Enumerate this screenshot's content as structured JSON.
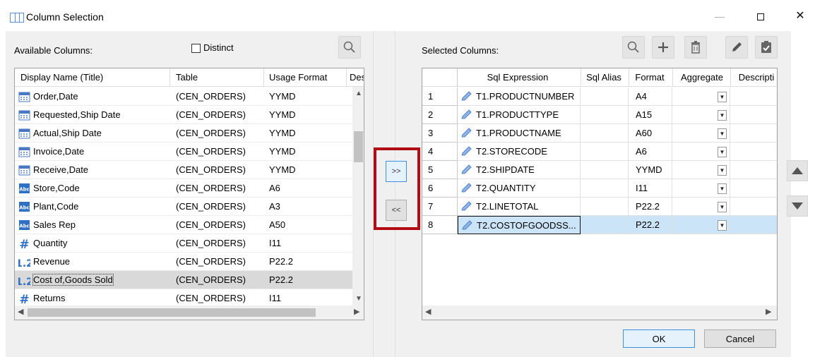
{
  "window": {
    "title": "Column Selection",
    "controls": {
      "minimize": "—",
      "close": "✕"
    }
  },
  "left": {
    "label": "Available Columns:",
    "distinct_label": "Distinct",
    "distinct_checked": false,
    "columns": [
      "Display Name (Title)",
      "Table",
      "Usage Format",
      "Desc"
    ],
    "rows": [
      {
        "icon": "calendar-icon",
        "name": "Order,Date",
        "table": "(CEN_ORDERS)",
        "format": "YYMD"
      },
      {
        "icon": "calendar-icon",
        "name": "Requested,Ship Date",
        "table": "(CEN_ORDERS)",
        "format": "YYMD"
      },
      {
        "icon": "calendar-icon",
        "name": "Actual,Ship Date",
        "table": "(CEN_ORDERS)",
        "format": "YYMD"
      },
      {
        "icon": "calendar-icon",
        "name": "Invoice,Date",
        "table": "(CEN_ORDERS)",
        "format": "YYMD"
      },
      {
        "icon": "calendar-icon",
        "name": "Receive,Date",
        "table": "(CEN_ORDERS)",
        "format": "YYMD"
      },
      {
        "icon": "text-field-icon",
        "name": "Store,Code",
        "table": "(CEN_ORDERS)",
        "format": "A6"
      },
      {
        "icon": "text-field-icon",
        "name": "Plant,Code",
        "table": "(CEN_ORDERS)",
        "format": "A3"
      },
      {
        "icon": "text-field-icon",
        "name": "Sales Rep",
        "table": "(CEN_ORDERS)",
        "format": "A50"
      },
      {
        "icon": "integer-field-icon",
        "name": "Quantity",
        "table": "(CEN_ORDERS)",
        "format": "I11"
      },
      {
        "icon": "decimal-field-icon",
        "name": "Revenue",
        "table": "(CEN_ORDERS)",
        "format": "P22.2"
      },
      {
        "icon": "decimal-field-icon",
        "name": "Cost of,Goods Sold",
        "table": "(CEN_ORDERS)",
        "format": "P22.2",
        "selected": true
      },
      {
        "icon": "integer-field-icon",
        "name": "Returns",
        "table": "(CEN_ORDERS)",
        "format": "I11"
      }
    ],
    "icon_text": {
      "text": "Abc",
      "integer": "#",
      "decimal": "1.2"
    }
  },
  "middle": {
    "add_label": ">>",
    "remove_label": "<<"
  },
  "right": {
    "label": "Selected Columns:",
    "columns": [
      "Sql Expression",
      "Sql Alias",
      "Format",
      "Aggregate",
      "Descripti"
    ],
    "rows": [
      {
        "num": "1",
        "expr": "T1.PRODUCTNUMBER",
        "alias": "",
        "format": "A4",
        "aggregate": ""
      },
      {
        "num": "2",
        "expr": "T1.PRODUCTTYPE",
        "alias": "",
        "format": "A15",
        "aggregate": ""
      },
      {
        "num": "3",
        "expr": "T1.PRODUCTNAME",
        "alias": "",
        "format": "A60",
        "aggregate": ""
      },
      {
        "num": "4",
        "expr": "T2.STORECODE",
        "alias": "",
        "format": "A6",
        "aggregate": ""
      },
      {
        "num": "5",
        "expr": "T2.SHIPDATE",
        "alias": "",
        "format": "YYMD",
        "aggregate": ""
      },
      {
        "num": "6",
        "expr": "T2.QUANTITY",
        "alias": "",
        "format": "I11",
        "aggregate": ""
      },
      {
        "num": "7",
        "expr": "T2.LINETOTAL",
        "alias": "",
        "format": "P22.2",
        "aggregate": ""
      },
      {
        "num": "8",
        "expr": "T2.COSTOFGOODSS...",
        "alias": "",
        "format": "P22.2",
        "aggregate": "",
        "selected": true
      }
    ]
  },
  "footer": {
    "ok_label": "OK",
    "cancel_label": "Cancel"
  },
  "colors": {
    "highlight_box": "#b00c12",
    "selected_row": "#cce4f7",
    "primary_border": "#3f8fe0"
  }
}
